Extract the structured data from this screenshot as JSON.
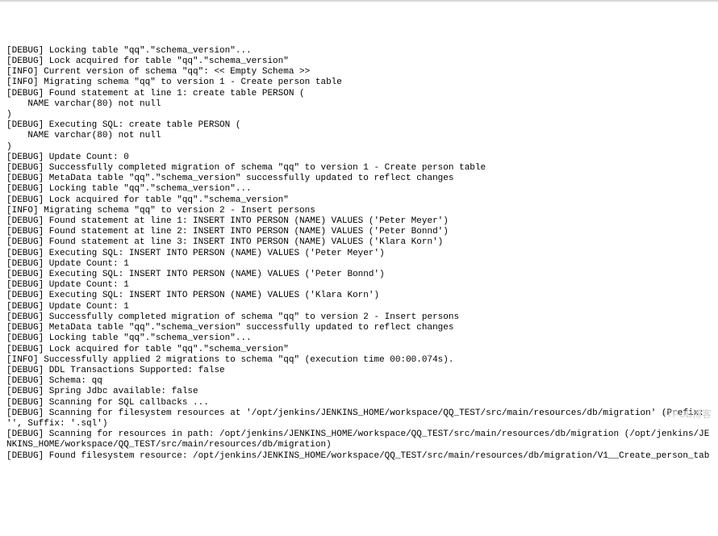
{
  "watermark": "ITPUB博客",
  "log": {
    "lines": [
      "[DEBUG] Locking table \"qq\".\"schema_version\"...",
      "[DEBUG] Lock acquired for table \"qq\".\"schema_version\"",
      "[INFO] Current version of schema \"qq\": << Empty Schema >>",
      "[INFO] Migrating schema \"qq\" to version 1 - Create person table",
      "[DEBUG] Found statement at line 1: create table PERSON (",
      "    NAME varchar(80) not null",
      ")",
      "[DEBUG] Executing SQL: create table PERSON (",
      "    NAME varchar(80) not null",
      ")",
      "[DEBUG] Update Count: 0",
      "[DEBUG] Successfully completed migration of schema \"qq\" to version 1 - Create person table",
      "[DEBUG] MetaData table \"qq\".\"schema_version\" successfully updated to reflect changes",
      "[DEBUG] Locking table \"qq\".\"schema_version\"...",
      "[DEBUG] Lock acquired for table \"qq\".\"schema_version\"",
      "[INFO] Migrating schema \"qq\" to version 2 - Insert persons",
      "[DEBUG] Found statement at line 1: INSERT INTO PERSON (NAME) VALUES ('Peter Meyer')",
      "[DEBUG] Found statement at line 2: INSERT INTO PERSON (NAME) VALUES ('Peter Bonnd')",
      "[DEBUG] Found statement at line 3: INSERT INTO PERSON (NAME) VALUES ('Klara Korn')",
      "[DEBUG] Executing SQL: INSERT INTO PERSON (NAME) VALUES ('Peter Meyer')",
      "[DEBUG] Update Count: 1",
      "[DEBUG] Executing SQL: INSERT INTO PERSON (NAME) VALUES ('Peter Bonnd')",
      "[DEBUG] Update Count: 1",
      "[DEBUG] Executing SQL: INSERT INTO PERSON (NAME) VALUES ('Klara Korn')",
      "[DEBUG] Update Count: 1",
      "[DEBUG] Successfully completed migration of schema \"qq\" to version 2 - Insert persons",
      "[DEBUG] MetaData table \"qq\".\"schema_version\" successfully updated to reflect changes",
      "[DEBUG] Locking table \"qq\".\"schema_version\"...",
      "[DEBUG] Lock acquired for table \"qq\".\"schema_version\"",
      "[INFO] Successfully applied 2 migrations to schema \"qq\" (execution time 00:00.074s).",
      "[DEBUG] DDL Transactions Supported: false",
      "[DEBUG] Schema: qq",
      "[DEBUG] Spring Jdbc available: false",
      "[DEBUG] Scanning for SQL callbacks ...",
      "[DEBUG] Scanning for filesystem resources at '/opt/jenkins/JENKINS_HOME/workspace/QQ_TEST/src/main/resources/db/migration' (Prefix: '', Suffix: '.sql')",
      "[DEBUG] Scanning for resources in path: /opt/jenkins/JENKINS_HOME/workspace/QQ_TEST/src/main/resources/db/migration (/opt/jenkins/JENKINS_HOME/workspace/QQ_TEST/src/main/resources/db/migration)",
      "[DEBUG] Found filesystem resource: /opt/jenkins/JENKINS_HOME/workspace/QQ_TEST/src/main/resources/db/migration/V1__Create_person_tab"
    ]
  }
}
